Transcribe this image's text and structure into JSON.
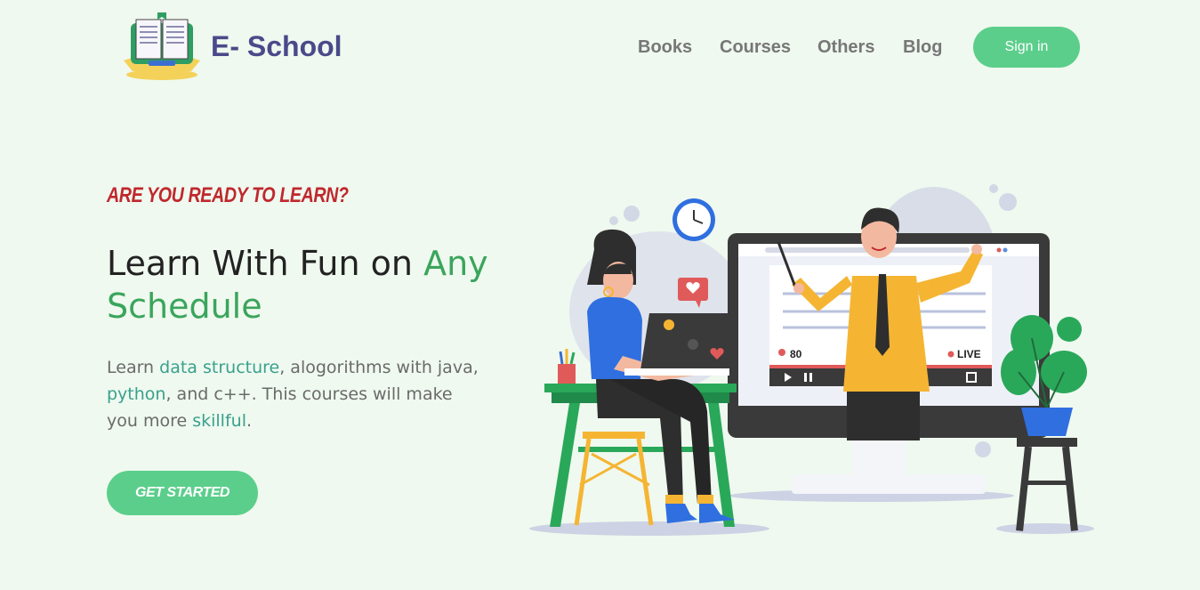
{
  "brand": {
    "name": "E- School",
    "logo_icon": "open-book-icon"
  },
  "nav": {
    "items": [
      {
        "label": "Books"
      },
      {
        "label": "Courses"
      },
      {
        "label": "Others"
      },
      {
        "label": "Blog"
      }
    ],
    "signin_label": "Sign in"
  },
  "hero": {
    "eyebrow": "ARE YOU READY TO LEARN?",
    "headline_part1": "Learn With Fun on ",
    "headline_part2": "Any",
    "headline_part3": "Schedule",
    "desc_1": "Learn ",
    "desc_2": "data structure",
    "desc_3": ", alogorithms with java, ",
    "desc_4": "python",
    "desc_5": ", and c++. This courses will make you more ",
    "desc_6": "skillful",
    "desc_7": ".",
    "cta_label": "GET STARTED"
  },
  "illustration": {
    "viewer_count": "80",
    "live_label": "LIVE"
  },
  "colors": {
    "background": "#eff9ef",
    "accent_green": "#5bce8b",
    "brand_text": "#4a4a8a",
    "eyebrow_red": "#c0282d",
    "headline_green": "#3aa55c"
  }
}
